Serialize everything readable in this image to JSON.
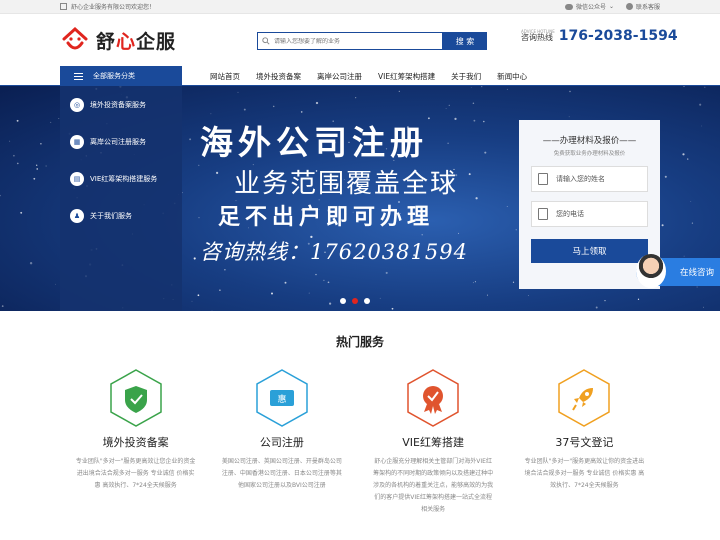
{
  "topbar": {
    "welcome": "舒心企业服务有限公司欢迎您！",
    "wechat": "微信公众号",
    "support": "联系客服"
  },
  "header": {
    "logo_prefix": "舒",
    "logo_red": "心",
    "logo_suffix": "企服",
    "search_placeholder": "请输入您想要了解的业务",
    "search_button": "搜 索",
    "hotline_en": "ADVICE HOTLINE",
    "hotline_label": "咨询热线",
    "hotline_number": "176-2038-1594"
  },
  "nav": {
    "category": "全部服务分类",
    "links": [
      "网站首页",
      "境外投资备案",
      "离岸公司注册",
      "VIE红筹架构搭建",
      "关于我们",
      "新闻中心"
    ]
  },
  "side_menu": [
    {
      "icon": "compass-icon",
      "label": "境外投资备案服务"
    },
    {
      "icon": "building-icon",
      "label": "离岸公司注册服务"
    },
    {
      "icon": "architecture-icon",
      "label": "VIE红筹架构搭建服务"
    },
    {
      "icon": "person-icon",
      "label": "关于我们服务"
    }
  ],
  "banner": {
    "line1": "海外公司注册",
    "line2": "业务范围覆盖全球",
    "line3": "足不出户即可办理",
    "line4": "咨询热线：17620381594"
  },
  "form": {
    "title": "——办理材料及报价——",
    "subtitle": "免费获取业务办理材料及报价",
    "name_placeholder": "请输入您的姓名",
    "phone_placeholder": "您的电话",
    "submit": "马上领取"
  },
  "online_chat": "在线咨询",
  "services_title": "热门服务",
  "services": [
    {
      "icon": "shield-icon",
      "color": "#3aa34a",
      "name": "境外投资备案",
      "desc": "专业团队\"多对一\"服务更高效让您企业的资金进出境合法合规多对一服务 专业诚信 价格实惠 高效执行、7*24全天候服务"
    },
    {
      "icon": "ticket-icon",
      "color": "#2aa0d8",
      "name": "公司注册",
      "desc": "美国公司注册、英国公司注册、开曼群岛公司注册、中国香港公司注册、日本公司注册等其他国家公司注册以及BVI公司注册"
    },
    {
      "icon": "medal-icon",
      "color": "#e0542e",
      "name": "VIE红筹搭建",
      "desc": "舒心企服充分理解相关主管部门对海外VIE红筹架构的不同时期的政策倾向以及搭建过种中涉及的各机构的着重关注点，能够高效的为我们的客户提供VIE红筹架构搭建一站式全流程相关服务"
    },
    {
      "icon": "rocket-icon",
      "color": "#f0a020",
      "name": "37号文登记",
      "desc": "专业团队\"多对一\"服务更高效让你的资金进出境合法合规多对一服务 专业诚信 价格实惠 高效执行、7*24全天候服务"
    }
  ]
}
